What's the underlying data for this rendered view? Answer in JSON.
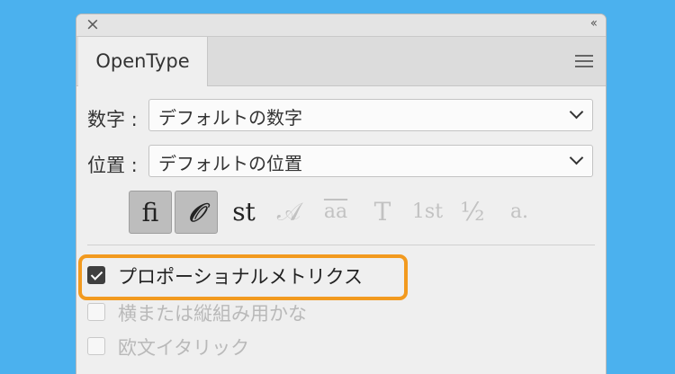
{
  "panel": {
    "tab_label": "OpenType",
    "numeral": {
      "label": "数字 :",
      "value": "デフォルトの数字"
    },
    "position": {
      "label": "位置 :",
      "value": "デフォルトの位置"
    },
    "glyph_buttons": [
      {
        "name": "standard-ligatures",
        "glyph": "fi",
        "state": "on"
      },
      {
        "name": "contextual-alternates",
        "glyph": "𝒪",
        "state": "on"
      },
      {
        "name": "discretionary-ligatures",
        "glyph": "st",
        "state": "enabled"
      },
      {
        "name": "swash",
        "glyph": "𝒜",
        "state": "off"
      },
      {
        "name": "stylistic-alternates",
        "glyph": "aa",
        "state": "off"
      },
      {
        "name": "titling-alternates",
        "glyph": "T",
        "state": "off"
      },
      {
        "name": "ordinals",
        "glyph": "1st",
        "state": "off"
      },
      {
        "name": "fractions",
        "glyph": "½",
        "state": "off"
      },
      {
        "name": "contextual-glyphs",
        "glyph": "a.",
        "state": "off"
      }
    ],
    "options": [
      {
        "label": "プロポーショナルメトリクス",
        "checked": true,
        "enabled": true
      },
      {
        "label": "横または縦組み用かな",
        "checked": false,
        "enabled": false
      },
      {
        "label": "欧文イタリック",
        "checked": false,
        "enabled": false
      }
    ]
  },
  "colors": {
    "background": "#4bb1ee",
    "highlight": "#f29a1f"
  }
}
